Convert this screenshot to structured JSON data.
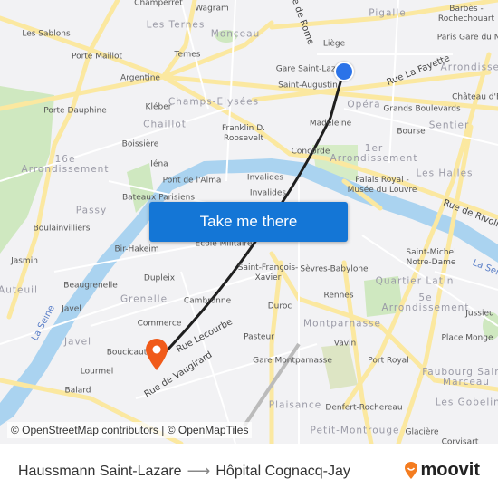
{
  "map": {
    "labels": {
      "districts": [
        {
          "id": "les-ternes",
          "text": "Les Ternes"
        },
        {
          "id": "monceau",
          "text": "Monceau"
        },
        {
          "id": "champs-elysees",
          "text": "Champs-Elysées"
        },
        {
          "id": "chaillot",
          "text": "Chaillot"
        },
        {
          "id": "16e",
          "text": "16e\nArrondissement"
        },
        {
          "id": "passy",
          "text": "Passy"
        },
        {
          "id": "auteuil",
          "text": "Auteuil"
        },
        {
          "id": "grenelle",
          "text": "Grenelle"
        },
        {
          "id": "javel",
          "text": "Javel"
        },
        {
          "id": "pigalle",
          "text": "Pigalle"
        },
        {
          "id": "opera",
          "text": "Opéra"
        },
        {
          "id": "sentier",
          "text": "Sentier"
        },
        {
          "id": "1er",
          "text": "1er\nArrondissement"
        },
        {
          "id": "les-halles",
          "text": "Les Halles"
        },
        {
          "id": "quartier-latin",
          "text": "Quartier Latin"
        },
        {
          "id": "5e",
          "text": "5e\nArrondissement"
        },
        {
          "id": "montparnasse",
          "text": "Montparnasse"
        },
        {
          "id": "plaisance",
          "text": "Plaisance"
        },
        {
          "id": "faubourg",
          "text": "Faubourg Saint-\nMarceau"
        },
        {
          "id": "gobelins",
          "text": "Les Gobelins"
        },
        {
          "id": "petit-montrouge",
          "text": "Petit-Montrouge"
        },
        {
          "id": "arrond-3",
          "text": "Arrondissement"
        }
      ],
      "places": [
        {
          "id": "champerret",
          "text": "Champerret"
        },
        {
          "id": "wagram",
          "text": "Wagram"
        },
        {
          "id": "les-sablons",
          "text": "Les Sablons"
        },
        {
          "id": "porte-maillot",
          "text": "Porte Maillot"
        },
        {
          "id": "ternes",
          "text": "Ternes"
        },
        {
          "id": "argentine",
          "text": "Argentine"
        },
        {
          "id": "porte-dauphine",
          "text": "Porte Dauphine"
        },
        {
          "id": "kleber",
          "text": "Kléber"
        },
        {
          "id": "boissiere",
          "text": "Boissière"
        },
        {
          "id": "iena",
          "text": "Iéna"
        },
        {
          "id": "pont-alma",
          "text": "Pont de l'Alma"
        },
        {
          "id": "bateaux",
          "text": "Bateaux Parisiens"
        },
        {
          "id": "boulainvilliers",
          "text": "Boulainvilliers"
        },
        {
          "id": "bir-hakeim",
          "text": "Bir-Hakeim"
        },
        {
          "id": "jasmin",
          "text": "Jasmin"
        },
        {
          "id": "dupleix",
          "text": "Dupleix"
        },
        {
          "id": "beaugrenelle",
          "text": "Beaugrenelle"
        },
        {
          "id": "javel-st",
          "text": "Javel"
        },
        {
          "id": "cambronne",
          "text": "Cambronne"
        },
        {
          "id": "commerce",
          "text": "Commerce"
        },
        {
          "id": "boucicaut",
          "text": "Boucicaut"
        },
        {
          "id": "lourmel",
          "text": "Lourmel"
        },
        {
          "id": "balard",
          "text": "Balard"
        },
        {
          "id": "liege",
          "text": "Liège"
        },
        {
          "id": "gare-st-lazare",
          "text": "Gare Saint-Lazare"
        },
        {
          "id": "saint-augustin",
          "text": "Saint-Augustin"
        },
        {
          "id": "barbes",
          "text": "Barbès -\nRochechouart"
        },
        {
          "id": "gare-du-nord",
          "text": "Paris Gare du Nord"
        },
        {
          "id": "chateau",
          "text": "Château d'Eau"
        },
        {
          "id": "grands-boulevards",
          "text": "Grands Boulevards"
        },
        {
          "id": "madeleine",
          "text": "Madeleine"
        },
        {
          "id": "bourse",
          "text": "Bourse"
        },
        {
          "id": "franklin",
          "text": "Franklin D.\nRoosevelt"
        },
        {
          "id": "concorde",
          "text": "Concorde"
        },
        {
          "id": "invalides-1",
          "text": "Invalides"
        },
        {
          "id": "invalides-2",
          "text": "Invalides"
        },
        {
          "id": "palais-royal",
          "text": "Palais Royal -\nMusée du Louvre"
        },
        {
          "id": "ecole-militaire",
          "text": "École Militaire"
        },
        {
          "id": "st-francois",
          "text": "Saint-François-\nXavier"
        },
        {
          "id": "sevres",
          "text": "Sèvres-Babylone"
        },
        {
          "id": "st-michel",
          "text": "Saint-Michel\nNotre-Dame"
        },
        {
          "id": "rennes",
          "text": "Rennes"
        },
        {
          "id": "jussieu",
          "text": "Jussieu"
        },
        {
          "id": "duroc",
          "text": "Duroc"
        },
        {
          "id": "place-monge",
          "text": "Place Monge"
        },
        {
          "id": "pasteur",
          "text": "Pasteur"
        },
        {
          "id": "vavin",
          "text": "Vavin"
        },
        {
          "id": "gare-montparnasse",
          "text": "Gare Montparnasse"
        },
        {
          "id": "port-royal",
          "text": "Port Royal"
        },
        {
          "id": "denfert",
          "text": "Denfert-Rochereau"
        },
        {
          "id": "glaciere",
          "text": "Glacière"
        },
        {
          "id": "corvisart",
          "text": "Corvisart"
        }
      ],
      "streets": [
        {
          "id": "rue-de-rome",
          "text": "Rue de Rome"
        },
        {
          "id": "rue-la-fayette",
          "text": "Rue La Fayette"
        },
        {
          "id": "rue-de-rivoli",
          "text": "Rue de Rivoli"
        },
        {
          "id": "rue-lecourbe",
          "text": "Rue Lecourbe"
        },
        {
          "id": "rue-de-vaugirard",
          "text": "Rue de Vaugirard"
        },
        {
          "id": "la-seine",
          "text": "La Seine"
        },
        {
          "id": "la-seine-2",
          "text": "La Seine"
        }
      ]
    },
    "origin_marker": "origin-dot",
    "destination_marker": "destination-pin",
    "attribution": "© OpenStreetMap contributors | © OpenMapTiles",
    "colors": {
      "route": "#1f1f1f",
      "origin": "#2b73e8",
      "destination": "#f05a19",
      "water": "#aad3f0",
      "park": "#cfe8c0",
      "road": "#fbe8a0"
    }
  },
  "cta": {
    "label": "Take me there"
  },
  "footer": {
    "origin": "Haussmann Saint-Lazare",
    "arrow": "⟶",
    "destination": "Hôpital Cognacq-Jay",
    "brand": "moovit"
  }
}
